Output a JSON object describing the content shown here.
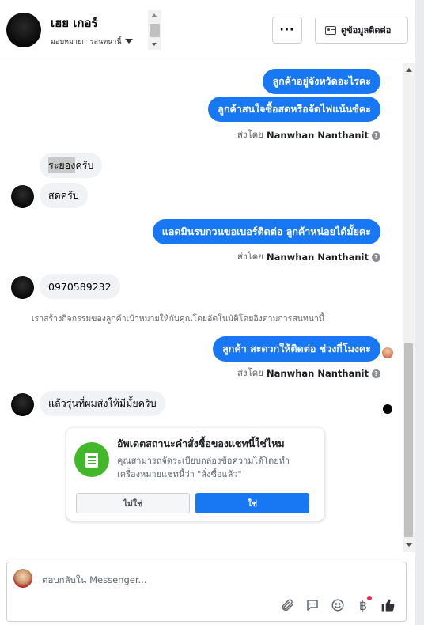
{
  "header": {
    "user_name": "เฮย เกอร์",
    "assign_label": "มอบหมายการสนทนานี้",
    "more_label": "···",
    "contact_label": "ดูข้อมูลติดต่อ"
  },
  "messages": {
    "out1": "ลูกค้าอยู่จังหวัดอะไรคะ",
    "out2": "ลูกค้าสนใจซื้อสดหรือจัดไฟแน้นซ์คะ",
    "sent_by_prefix": "ส่งโดย",
    "sent_by_name": "Nanwhan Nanthanit",
    "in1_highlight": "ระยอง",
    "in1_rest": "ครับ",
    "in2": "สดครับ",
    "out3": "แอดมินรบกวนขอเบอร์ติดต่อ ลูกค้าหน่อยได้มั้ยคะ",
    "in3": "0970589232",
    "system_note": "เราสร้างกิจกรรมของลูกค้าเป้าหมายให้กับคุณโดยอัตโนมัติโดยอิงตามการสนทนานี้",
    "out4": "ลูกค้า สะดวกให้ติดต่อ ช่วงกี่โมงคะ",
    "in4": "แล้วรุ่นที่ผมส่งให้มีมั้ยครับ"
  },
  "status_card": {
    "title": "อัพเดตสถานะคำสั่งซื้อของแชทนี้ใช่ไหม",
    "body": "คุณสามารถจัดระเบียบกล่องข้อความได้โดยทำเครื่องหมายแชทนี้ว่า \"สั่งซื้อแล้ว\"",
    "no_label": "ไม่ใช่",
    "yes_label": "ใช่"
  },
  "composer": {
    "placeholder": "ตอบกลับใน Messenger...",
    "baht_symbol": "฿"
  },
  "colors": {
    "accent": "#1877f2",
    "success": "#42b72a",
    "incoming_bubble": "#f0f2f5",
    "badge_dot": "#f02849"
  },
  "icons": {
    "more": "ellipsis-icon",
    "contact": "id-card-icon",
    "help": "question-icon",
    "attach": "paperclip-icon",
    "saved_replies": "chat-bubble-icon",
    "emoji": "smiley-icon",
    "payment": "baht-icon",
    "like": "thumbs-up-icon",
    "status": "receipt-icon"
  }
}
